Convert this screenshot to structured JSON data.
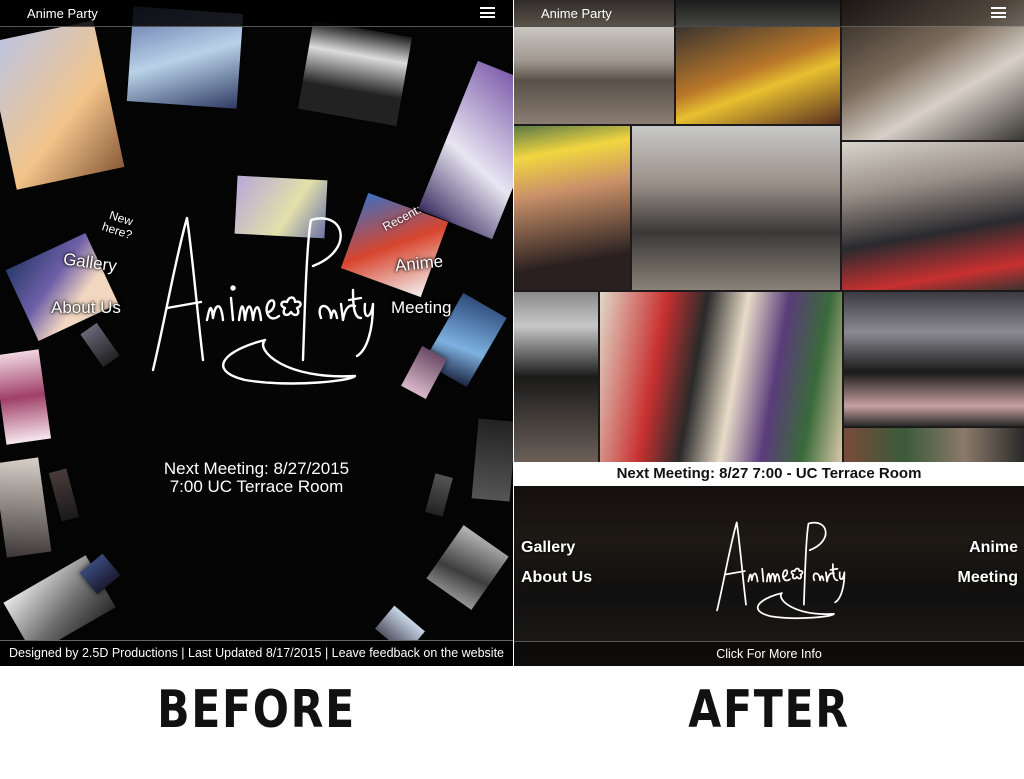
{
  "before": {
    "topbar_title": "Anime Party",
    "logo_text": "Anime✿Party",
    "new_here": "New here?",
    "recent": "Recent:",
    "nav": {
      "gallery": "Gallery",
      "about": "About Us",
      "anime": "Anime",
      "meeting": "Meeting"
    },
    "next_meeting_line1": "Next Meeting: 8/27/2015",
    "next_meeting_line2": "7:00 UC Terrace Room",
    "footer": "Designed by 2.5D Productions | Last Updated 8/17/2015 | Leave feedback on the website",
    "caption": "BEFORE"
  },
  "after": {
    "topbar_title": "Anime Party",
    "logo_text": "Anime✿Party",
    "next_meeting": "Next Meeting: 8/27 7:00 - UC Terrace Room",
    "nav": {
      "gallery": "Gallery",
      "about": "About Us",
      "anime": "Anime",
      "meeting": "Meeting"
    },
    "footer": "Click For More Info",
    "caption": "AFTER"
  },
  "colors": {
    "before_bg": "#050505",
    "after_banner": "#ffffff",
    "caption_text": "#111111"
  }
}
